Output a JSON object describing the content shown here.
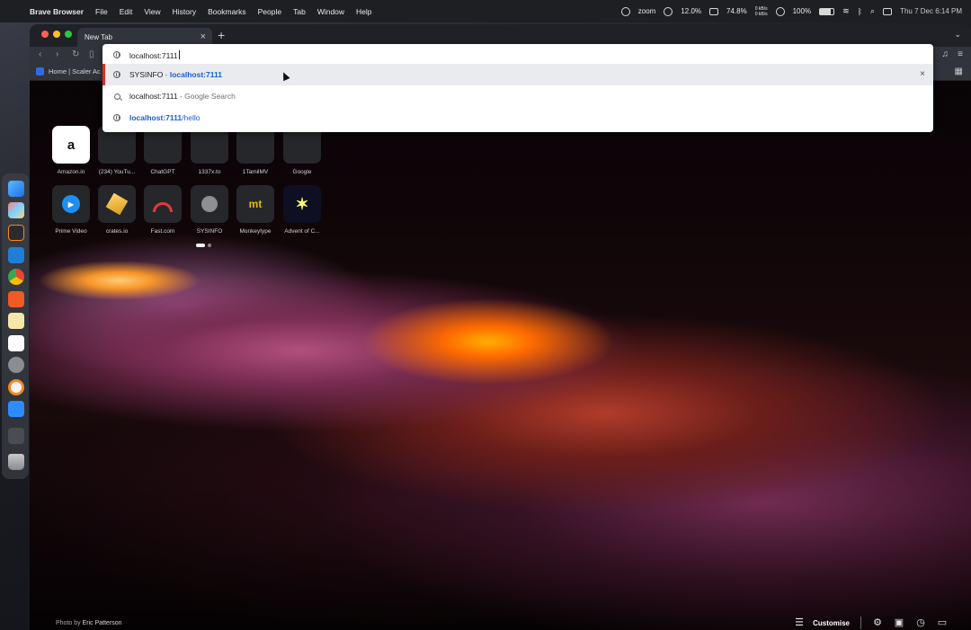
{
  "menubar": {
    "app_name": "Brave Browser",
    "menus": [
      "File",
      "Edit",
      "View",
      "History",
      "Bookmarks",
      "People",
      "Tab",
      "Window",
      "Help"
    ],
    "zoom_label": "zoom",
    "cpu": "12.0%",
    "mem": "74.8%",
    "net_up": "0 kB/s",
    "net_down": "0 kB/s",
    "battery": "100%",
    "datetime": "Thu 7 Dec 6:14 PM"
  },
  "browser": {
    "tab_title": "New Tab",
    "bookmark_item": "Home | Scaler Ac"
  },
  "omnibox": {
    "input_value": "localhost:7111",
    "suggestions": [
      {
        "icon": "globe-icon",
        "title": "SYSINFO",
        "separator": " - ",
        "url": "localhost:7111",
        "selected": true
      },
      {
        "icon": "search-icon",
        "query": "localhost:7111",
        "separator": " - ",
        "engine": "Google Search"
      },
      {
        "icon": "globe-icon",
        "url_bold": "localhost:7111",
        "url_rest": "/hello"
      }
    ]
  },
  "ntp": {
    "top_sites_row1": [
      {
        "label": "Amazon.in",
        "icon_text": "a"
      },
      {
        "label": "(234) YouTu...",
        "icon_text": ""
      },
      {
        "label": "ChatGPT",
        "icon_text": ""
      },
      {
        "label": "1337x.to",
        "icon_text": ""
      },
      {
        "label": "1TamilMV",
        "icon_text": ""
      },
      {
        "label": "Google",
        "icon_text": ""
      }
    ],
    "top_sites_row2": [
      {
        "label": "Prime Video",
        "icon_text": "▶"
      },
      {
        "label": "crates.io",
        "icon_text": ""
      },
      {
        "label": "Fast.com",
        "icon_text": ""
      },
      {
        "label": "SYSINFO",
        "icon_text": ""
      },
      {
        "label": "Monkeytype",
        "icon_text": "mt"
      },
      {
        "label": "Advent of C...",
        "icon_text": "✶"
      }
    ],
    "photo_credit_prefix": "Photo by",
    "photo_author": "Eric Patterson",
    "customise_label": "Customise"
  },
  "colors": {
    "accent_link": "#1a5bd4",
    "selected_marker": "#d93025"
  }
}
